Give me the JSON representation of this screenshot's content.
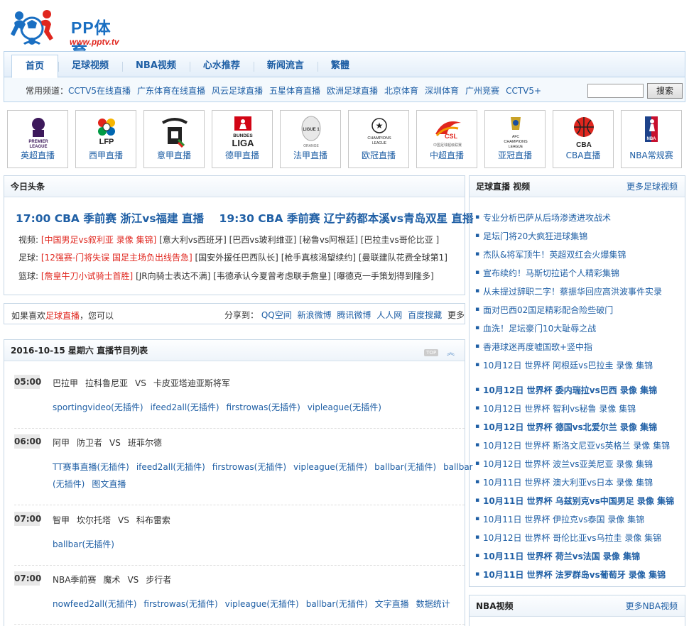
{
  "logo": {
    "title": "PP体育",
    "url": "www.pptv.tv"
  },
  "nav": {
    "tabs": [
      "首页",
      "足球视频",
      "NBA视频",
      "心水推荐",
      "新闻流言",
      "繁體"
    ],
    "channels_label": "常用频道：",
    "channels": [
      "CCTV5在线直播",
      "广东体育在线直播",
      "风云足球直播",
      "五星体育直播",
      "欧洲足球直播",
      "北京体育",
      "深圳体育",
      "广州竞赛",
      "CCTV5+"
    ],
    "search_button": "搜索"
  },
  "leagues": [
    "英超直播",
    "西甲直播",
    "意甲直播",
    "德甲直播",
    "法甲直播",
    "欧冠直播",
    "中超直播",
    "亚冠直播",
    "CBA直播",
    "NBA常规赛"
  ],
  "today": {
    "title": "今日头条",
    "headline1": "17:00 CBA 季前赛 浙江vs福建 直播",
    "headline2": "19:30 CBA 季前赛 辽宁药都本溪vs青岛双星 直播",
    "video": {
      "label": "视频:",
      "hot": "[中国男足vs叙利亚 录像 集锦]",
      "items": [
        "[意大利vs西班牙]",
        "[巴西vs玻利维亚]",
        "[秘鲁vs阿根廷]",
        "[巴拉圭vs哥伦比亚 ]"
      ]
    },
    "football": {
      "label": "足球:",
      "hot": "[12强赛-门将失误 国足主场负出线告急]",
      "items": [
        "[国安外援任巴西队长]",
        "[枪手真核渴望续约]",
        "[曼联建队花费全球第1]"
      ]
    },
    "basketball": {
      "label": "篮球:",
      "hot": "[詹皇牛刀小试骑士首胜]",
      "items": [
        "[JR向骑士表达不满]",
        "[韦德承认今夏曾考虑联手詹皇]",
        "[曝德克一手策划得到隆多]"
      ]
    }
  },
  "share": {
    "prefix": "如果喜欢",
    "site": "足球直播",
    "suffix": "，您可以",
    "label": "分享到：",
    "links": [
      "QQ空间",
      "新浪微博",
      "腾讯微博",
      "人人网",
      "百度搜藏",
      "更多"
    ]
  },
  "schedule": {
    "title": "2016-10-15 星期六 直播节目列表",
    "top_label": "TOP",
    "entries": [
      {
        "time": "05:00",
        "league": "巴拉甲",
        "home": "拉科鲁尼亚",
        "vs": "VS",
        "away": "卡皮亚塔迪亚斯将军",
        "links": [
          "sportingvideo(无插件)",
          "ifeed2all(无插件)",
          "firstrowas(无插件)",
          "vipleague(无插件)"
        ]
      },
      {
        "time": "06:00",
        "league": "阿甲",
        "home": "防卫者",
        "vs": "VS",
        "away": "班菲尔德",
        "links": [
          "TT赛事直播(无插件)",
          "ifeed2all(无插件)",
          "firstrowas(无插件)",
          "vipleague(无插件)",
          "ballbar(无插件)",
          "ballbar",
          "(无插件)",
          "图文直播"
        ]
      },
      {
        "time": "07:00",
        "league": "智甲",
        "home": "坎尔托塔",
        "vs": "VS",
        "away": "科布雷索",
        "links": [
          "ballbar(无插件)"
        ]
      },
      {
        "time": "07:00",
        "league": "NBA季前赛",
        "home": "魔术",
        "vs": "VS",
        "away": "步行者",
        "links": [
          "nowfeed2all(无插件)",
          "firstrowas(无插件)",
          "vipleague(无插件)",
          "ballbar(无插件)",
          "文字直播",
          "数据统计"
        ]
      }
    ]
  },
  "football_videos": {
    "title": "足球直播 视频",
    "more": "更多足球视频",
    "items": [
      {
        "text": "专业分析巴萨从后场渗透进攻战术",
        "bold": false
      },
      {
        "text": "足坛门将20大疯狂进球集锦",
        "bold": false
      },
      {
        "text": "杰队&将军顶牛！英超双红会火爆集锦",
        "bold": false
      },
      {
        "text": "宣布续约！马斯切拉诺个人精彩集锦",
        "bold": false
      },
      {
        "text": "从未提过辞职二字！蔡振华回应高洪波事件实录",
        "bold": false
      },
      {
        "text": "面对巴西02国足精彩配合险些破门",
        "bold": false
      },
      {
        "text": "血洗！足坛豪门10大耻辱之战",
        "bold": false
      },
      {
        "text": "香港球迷再度嘘国歌+竖中指",
        "bold": false
      },
      {
        "text": "10月12日 世界杯 阿根廷vs巴拉圭 录像 集锦",
        "bold": false
      },
      {
        "text": "10月12日 世界杯 委内瑞拉vs巴西 录像 集锦",
        "bold": true
      },
      {
        "text": "10月12日 世界杯 智利vs秘鲁 录像 集锦",
        "bold": false
      },
      {
        "text": "10月12日 世界杯 德国vs北爱尔兰 录像 集锦",
        "bold": true
      },
      {
        "text": "10月12日 世界杯 斯洛文尼亚vs英格兰 录像 集锦",
        "bold": false
      },
      {
        "text": "10月12日 世界杯 波兰vs亚美尼亚 录像 集锦",
        "bold": false
      },
      {
        "text": "10月11日 世界杯 澳大利亚vs日本 录像 集锦",
        "bold": false
      },
      {
        "text": "10月11日 世界杯 乌兹别克vs中国男足 录像 集锦",
        "bold": true
      },
      {
        "text": "10月11日 世界杯 伊拉克vs泰国 录像 集锦",
        "bold": false
      },
      {
        "text": "10月12日 世界杯 哥伦比亚vs乌拉圭 录像 集锦",
        "bold": false
      },
      {
        "text": "10月11日 世界杯 荷兰vs法国 录像 集锦",
        "bold": true
      },
      {
        "text": "10月11日 世界杯 法罗群岛vs葡萄牙 录像 集锦",
        "bold": true
      }
    ]
  },
  "nba_videos": {
    "title": "NBA视频",
    "more": "更多NBA视频"
  }
}
